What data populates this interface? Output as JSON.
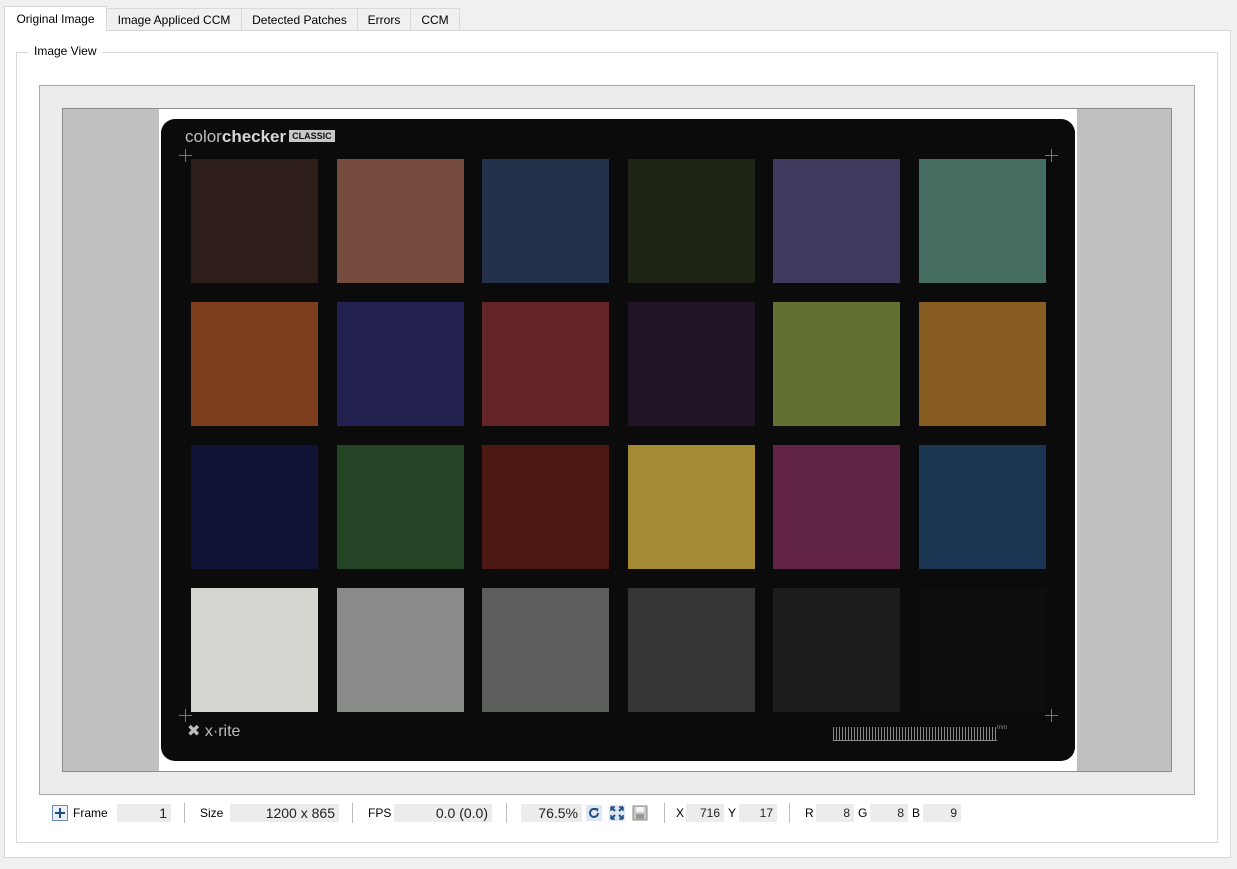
{
  "tabs": [
    {
      "label": "Original Image",
      "active": true
    },
    {
      "label": "Image Appliced CCM",
      "active": false
    },
    {
      "label": "Detected Patches",
      "active": false
    },
    {
      "label": "Errors",
      "active": false
    },
    {
      "label": "CCM",
      "active": false
    }
  ],
  "group": {
    "title": "Image View"
  },
  "image": {
    "brand_prefix": "color",
    "brand_bold": "checker",
    "brand_badge": "CLASSIC",
    "maker": "x·rite",
    "ruler_unit": "mm",
    "patch_colors": [
      "#2e1e19",
      "#754b3e",
      "#24314a",
      "#1f2515",
      "#413a5f",
      "#476e62",
      "#7b3d1c",
      "#22214f",
      "#632427",
      "#221427",
      "#627130",
      "#885d23",
      "#101335",
      "#234425",
      "#4d1714",
      "#a48a33",
      "#622446",
      "#1a3652",
      "#d5d6cf",
      "#898b88",
      "#5c5e5b",
      "#353535",
      "#1b1c1b",
      "#0e0e0e"
    ]
  },
  "toolbar": {
    "frame_label": "Frame",
    "frame_value": "1",
    "size_label": "Size",
    "size_value": "1200 x 865",
    "fps_label": "FPS",
    "fps_value": "0.0 (0.0)",
    "zoom_value": "76.5%",
    "x_label": "X",
    "x_value": "716",
    "y_label": "Y",
    "y_value": "17",
    "r_label": "R",
    "r_value": "8",
    "g_label": "G",
    "g_value": "8",
    "b_label": "B",
    "b_value": "9"
  }
}
